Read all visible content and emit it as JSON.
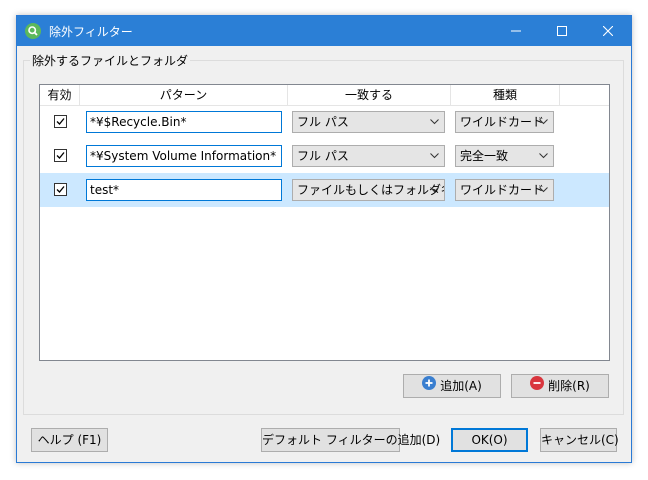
{
  "window": {
    "title": "除外フィルター"
  },
  "group": {
    "label": "除外するファイルとフォルダ"
  },
  "table": {
    "columns": [
      "有効",
      "パターン",
      "一致する",
      "種類"
    ],
    "rows": [
      {
        "enabled": true,
        "pattern": "*¥$Recycle.Bin*",
        "match": "フル パス",
        "kind": "ワイルドカード"
      },
      {
        "enabled": true,
        "pattern": "*¥System Volume Information*",
        "match": "フル パス",
        "kind": "完全一致"
      },
      {
        "enabled": true,
        "pattern": "test*",
        "match": "ファイルもしくはフォルダ名",
        "kind": "ワイルドカード"
      }
    ]
  },
  "buttons": {
    "add": "追加(A)",
    "delete": "削除(R)",
    "help": "ヘルプ (F1)",
    "add_defaults": "デフォルト フィルターの追加(D)",
    "ok": "OK(O)",
    "cancel": "キャンセル(C)"
  },
  "colors": {
    "titlebar": "#2b7fd6",
    "selection": "#cce8ff",
    "add_icon": "#3a7fd0",
    "delete_icon": "#d9363e"
  },
  "icons": {
    "app": "search-icon",
    "add": "plus-circle-icon",
    "delete": "minus-circle-icon"
  }
}
